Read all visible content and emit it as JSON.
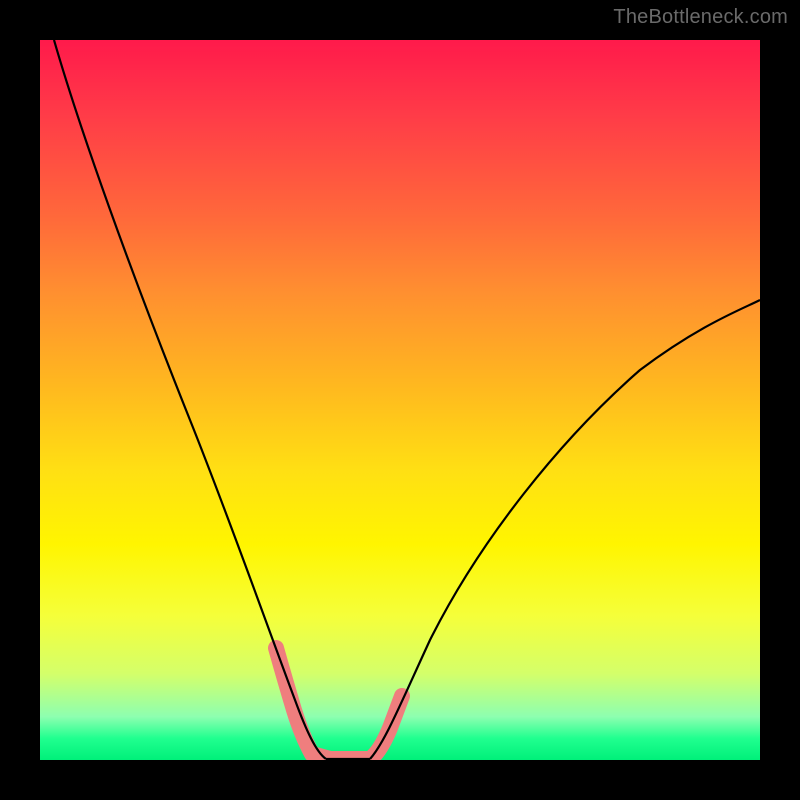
{
  "attribution": "TheBottleneck.com",
  "chart_data": {
    "type": "line",
    "title": "",
    "xlabel": "",
    "ylabel": "",
    "xlim": [
      0,
      100
    ],
    "ylim": [
      0,
      100
    ],
    "gradient_stops": [
      {
        "pos": 0,
        "color": "#ff1a4b"
      },
      {
        "pos": 10,
        "color": "#ff3a48"
      },
      {
        "pos": 25,
        "color": "#ff6a3a"
      },
      {
        "pos": 35,
        "color": "#ff8f30"
      },
      {
        "pos": 48,
        "color": "#ffb81f"
      },
      {
        "pos": 60,
        "color": "#ffe013"
      },
      {
        "pos": 70,
        "color": "#fff500"
      },
      {
        "pos": 80,
        "color": "#f5ff3a"
      },
      {
        "pos": 88,
        "color": "#d4ff6a"
      },
      {
        "pos": 94,
        "color": "#8dffb0"
      },
      {
        "pos": 97,
        "color": "#20ff8f"
      },
      {
        "pos": 100,
        "color": "#00f07a"
      }
    ],
    "series": [
      {
        "name": "left-branch",
        "x": [
          2,
          5,
          10,
          15,
          20,
          25,
          27,
          29,
          31,
          33,
          35,
          36,
          37,
          38
        ],
        "y": [
          100,
          88,
          74,
          60,
          47,
          32,
          25,
          18,
          12,
          7,
          3,
          1.5,
          0.5,
          0
        ]
      },
      {
        "name": "valley-floor",
        "x": [
          38,
          40,
          42,
          44,
          46
        ],
        "y": [
          0,
          0,
          0,
          0,
          0
        ]
      },
      {
        "name": "right-branch",
        "x": [
          46,
          48,
          50,
          54,
          60,
          70,
          80,
          90,
          100
        ],
        "y": [
          0,
          2,
          5,
          12,
          22,
          36,
          47,
          56,
          64
        ]
      }
    ],
    "highlight_band": {
      "color": "#f07a7a",
      "thickness": 14,
      "covers_x": [
        33,
        50
      ],
      "covers_y_below": 15
    },
    "curve_stroke": {
      "color": "#000000",
      "width": 2
    }
  }
}
